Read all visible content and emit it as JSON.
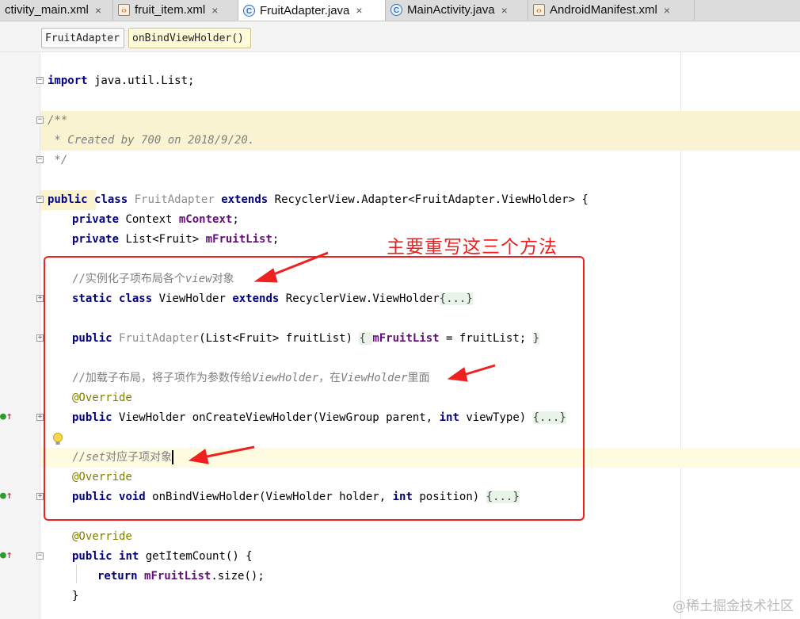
{
  "tabs": [
    {
      "label": "ctivity_main.xml",
      "icon": "none",
      "active": false
    },
    {
      "label": "fruit_item.xml",
      "icon": "xml-file-icon",
      "active": false
    },
    {
      "label": "FruitAdapter.java",
      "icon": "class-file-icon",
      "active": true
    },
    {
      "label": "MainActivity.java",
      "icon": "class-file-icon",
      "active": false
    },
    {
      "label": "AndroidManifest.xml",
      "icon": "manifest-file-icon",
      "active": false
    }
  ],
  "tab_close_glyph": "×",
  "breadcrumbs": {
    "cls": "FruitAdapter",
    "method": "onBindViewHolder()"
  },
  "code": {
    "import_kw": "import",
    "import_path": " java.util.List;",
    "doc_open": "/**",
    "doc_line": " * Created by 700 on 2018/9/20.",
    "doc_close": " */",
    "class_decl": {
      "public": "public",
      "class": "class",
      "name": "FruitAdapter",
      "extends": "extends",
      "parent": "RecyclerView.Adapter<FruitAdapter.ViewHolder> {"
    },
    "ctx_field": {
      "private": "private",
      "type": " Context ",
      "name": "mContext",
      "end": ";"
    },
    "list_field": {
      "private": "private",
      "type": " List<Fruit> ",
      "name": "mFruitList",
      "end": ";"
    },
    "comment1": "//实例化子项布局各个",
    "comment1_em": "view",
    "comment1_end": "对象",
    "viewholder_decl": {
      "static": "static",
      "class": "class",
      "name": " ViewHolder ",
      "extends": "extends",
      "parent": " RecyclerView.ViewHolder",
      "fold": "{...}"
    },
    "ctor_decl": {
      "public": "public",
      "name": "FruitAdapter",
      "params": "(List<Fruit> fruitList) ",
      "open": "{ ",
      "field": "mFruitList",
      "rest": " = fruitList; ",
      "close": "}"
    },
    "comment2": "//加载子布局，将子项作为参数传给",
    "comment2_em1": "ViewHolder",
    "comment2_mid": "，在",
    "comment2_em2": "ViewHolder",
    "comment2_end": "里面",
    "override": "@Override",
    "create_decl": {
      "public": "public",
      "sig": " ViewHolder onCreateViewHolder(ViewGroup parent, ",
      "int": "int",
      "rest": " viewType) ",
      "fold": "{...}"
    },
    "comment3_a": "//",
    "comment3_em": "set",
    "comment3_b": "对应子项对象",
    "bind_decl": {
      "public": "public",
      "void": "void",
      "sig": " onBindViewHolder(ViewHolder holder, ",
      "int": "int",
      "rest": " position) ",
      "fold": "{...}"
    },
    "count_decl": {
      "public": "public",
      "int": "int",
      "rest": " getItemCount() {"
    },
    "return_stmt": {
      "return": "return",
      "field": "mFruitList",
      "rest": ".size();"
    },
    "close_brace": "}"
  },
  "annotation_note": "主要重写这三个方法",
  "watermark": "@稀土掘金技术社区",
  "colors": {
    "keyword": "#000080",
    "field": "#660e7a",
    "comment": "#808080",
    "annotation": "#808000",
    "red_markup": "#ee2020",
    "doc_highlight": "#faf3d2"
  }
}
